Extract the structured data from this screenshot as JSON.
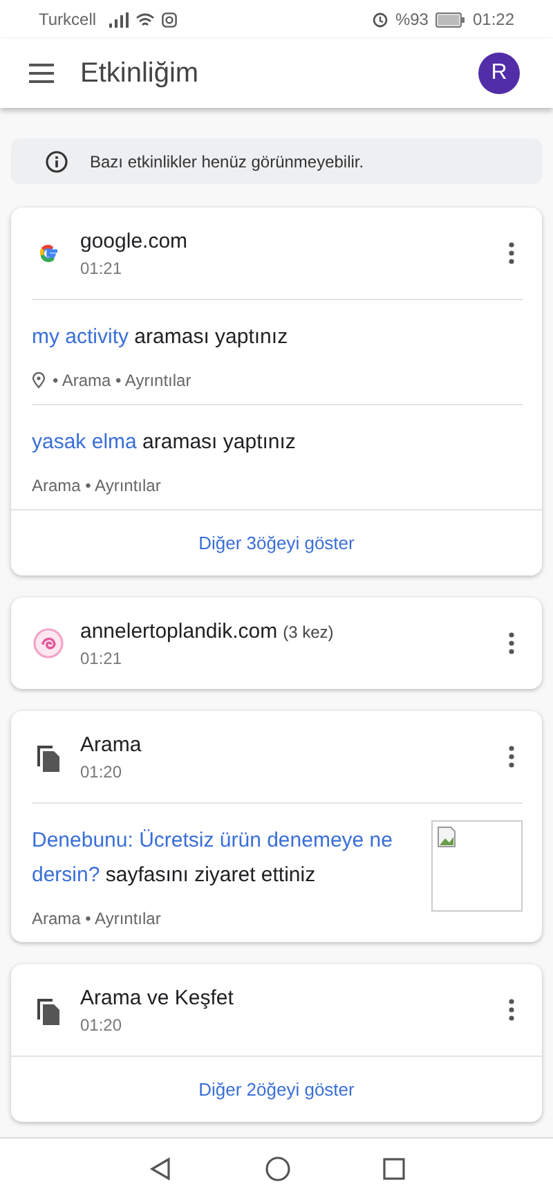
{
  "status_bar": {
    "carrier": "Turkcell",
    "battery": "%93",
    "time": "01:22"
  },
  "app_bar": {
    "title": "Etkinliğim",
    "avatar": "R"
  },
  "notice": {
    "text": "Bazı etkinlikler henüz görünmeyebilir."
  },
  "cards": [
    {
      "kind": "google",
      "title": "google.com",
      "time": "01:21",
      "entries": [
        {
          "kind": "located",
          "link": "my activity",
          "text": " araması yaptınız",
          "meta": "• Arama • Ayrıntılar"
        },
        {
          "kind": "plain",
          "link": "yasak elma",
          "text": " araması yaptınız",
          "meta": "Arama • Ayrıntılar"
        }
      ],
      "more": "Diğer 3öğeyi göster"
    },
    {
      "kind": "site",
      "title": "annelertoplandik.com",
      "count": "(3 kez)",
      "time": "01:21"
    },
    {
      "kind": "document",
      "title": "Arama",
      "time": "01:20",
      "entries": [
        {
          "kind": "page",
          "link": "Denebunu: Ücretsiz ürün denemeye ne dersin?",
          "text": " sayfasını ziyaret ettiniz",
          "meta": "Arama • Ayrıntılar"
        }
      ]
    },
    {
      "kind": "document",
      "title": "Arama ve Keşfet",
      "time": "01:20",
      "more": "Diğer 2öğeyi göster"
    }
  ]
}
